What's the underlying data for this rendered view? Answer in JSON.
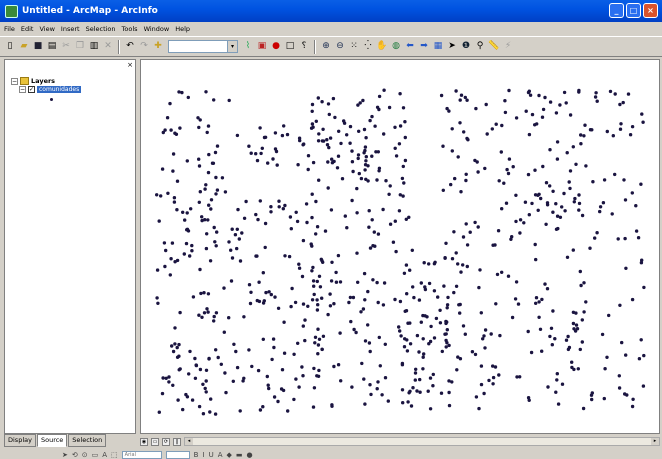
{
  "window": {
    "title": "Untitled - ArcMap - ArcInfo"
  },
  "menu": [
    "File",
    "Edit",
    "View",
    "Insert",
    "Selection",
    "Tools",
    "Window",
    "Help"
  ],
  "toolbar": {
    "scale_value": ""
  },
  "toc": {
    "root_label": "Layers",
    "layer_name": "comunidades",
    "tabs": [
      "Display",
      "Source",
      "Selection"
    ]
  },
  "drawing": {
    "font_value": "Arial"
  },
  "colors": {
    "point_symbol": "#1a1440",
    "title_bar": "#0053e1",
    "selection": "#316ac5"
  }
}
